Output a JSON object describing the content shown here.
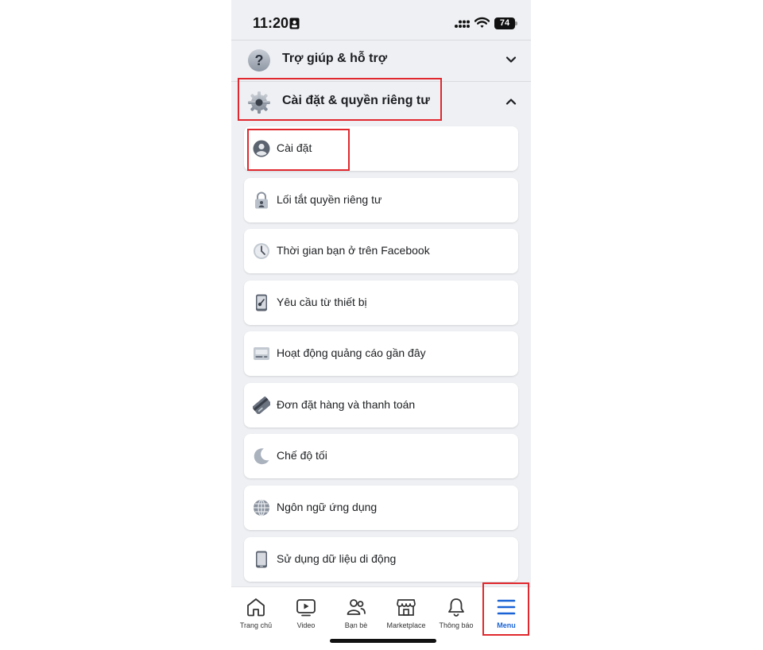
{
  "status_bar": {
    "time": "11:20",
    "battery": "74"
  },
  "sections": [
    {
      "label": "Trợ giúp & hỗ trợ",
      "icon": "help-icon",
      "state": "collapsed"
    },
    {
      "label": "Cài đặt & quyền riêng tư",
      "icon": "gear-icon",
      "state": "expanded"
    }
  ],
  "items": [
    {
      "label": "Cài đặt",
      "icon": "profile-icon"
    },
    {
      "label": "Lối tắt quyền riêng tư",
      "icon": "lock-icon"
    },
    {
      "label": "Thời gian bạn ở trên Facebook",
      "icon": "clock-icon"
    },
    {
      "label": "Yêu cầu từ thiết bị",
      "icon": "device-key-icon"
    },
    {
      "label": "Hoạt động quảng cáo gần đây",
      "icon": "ad-activity-icon"
    },
    {
      "label": "Đơn đặt hàng và thanh toán",
      "icon": "credit-card-icon"
    },
    {
      "label": "Chế độ tối",
      "icon": "moon-icon"
    },
    {
      "label": "Ngôn ngữ ứng dụng",
      "icon": "globe-icon"
    },
    {
      "label": "Sử dụng dữ liệu di động",
      "icon": "phone-icon"
    }
  ],
  "nav": [
    {
      "label": "Trang chủ",
      "icon": "home-icon"
    },
    {
      "label": "Video",
      "icon": "video-icon"
    },
    {
      "label": "Bạn bè",
      "icon": "friends-icon"
    },
    {
      "label": "Marketplace",
      "icon": "marketplace-icon"
    },
    {
      "label": "Thông báo",
      "icon": "bell-icon"
    },
    {
      "label": "Menu",
      "icon": "menu-icon",
      "active": true
    }
  ],
  "colors": {
    "highlight": "#e0282e",
    "active_tab": "#1a63d6",
    "background": "#eef0f3"
  }
}
